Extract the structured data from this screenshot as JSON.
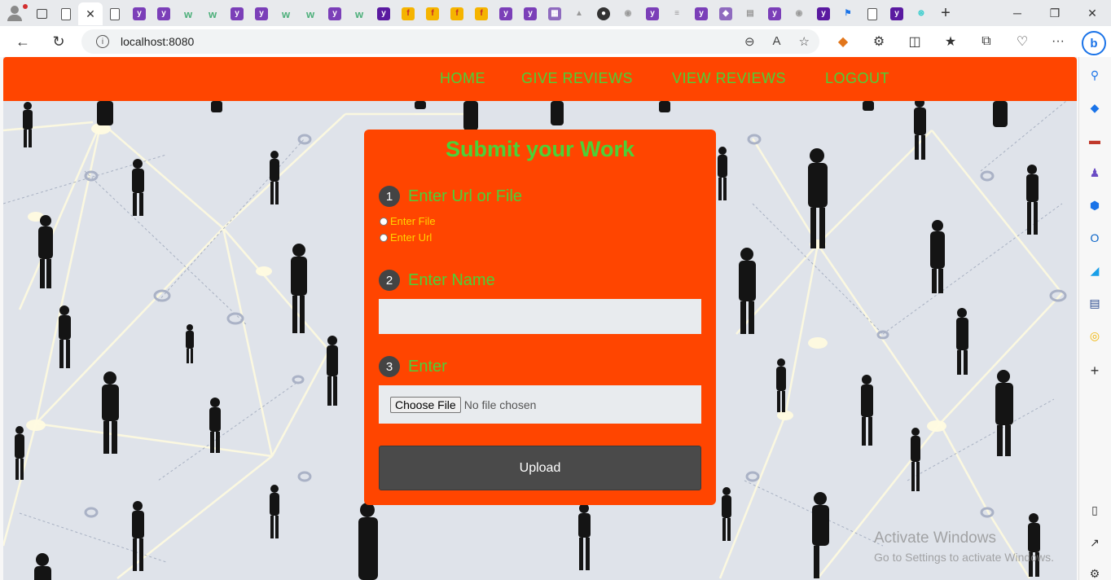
{
  "browser": {
    "url": "localhost:8080"
  },
  "nav": {
    "items": [
      "HOME",
      "GIVE REVIEWS",
      "VIEW REVIEWS",
      "LOGOUT"
    ]
  },
  "form": {
    "title": "Submit your Work",
    "step1": {
      "num": "1",
      "label": "Enter Url or File"
    },
    "options": [
      "Enter File",
      "Enter Url"
    ],
    "step2": {
      "num": "2",
      "label": "Enter Name"
    },
    "name_value": "",
    "step3": {
      "num": "3",
      "label": "Enter"
    },
    "file_button": "Choose File",
    "file_status": "No file chosen",
    "upload_label": "Upload"
  },
  "watermark": {
    "line1": "Activate Windows",
    "line2": "Go to Settings to activate Windows."
  },
  "colors": {
    "accent": "#ff4500",
    "green_text": "#4cd137",
    "radio_text": "#ffd400",
    "button_dark": "#4a4a4a"
  }
}
